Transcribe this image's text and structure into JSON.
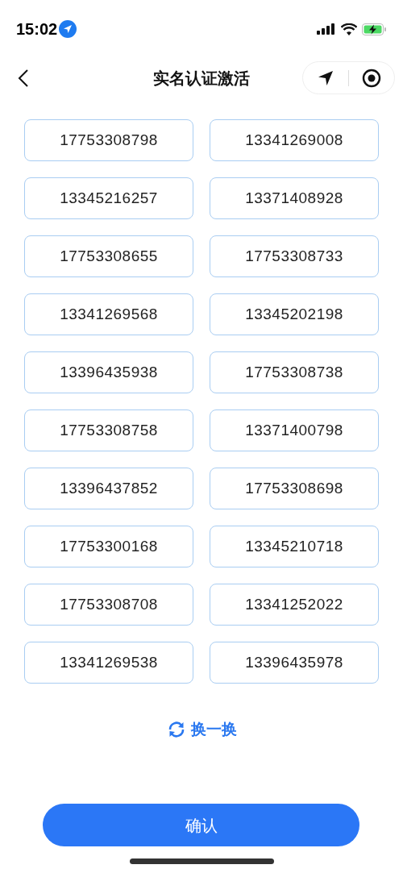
{
  "status_bar": {
    "time": "15:02"
  },
  "nav": {
    "title": "实名认证激活"
  },
  "numbers": [
    "17753308798",
    "13341269008",
    "13345216257",
    "13371408928",
    "17753308655",
    "17753308733",
    "13341269568",
    "13345202198",
    "13396435938",
    "17753308738",
    "17753308758",
    "13371400798",
    "13396437852",
    "17753308698",
    "17753300168",
    "13345210718",
    "17753308708",
    "13341252022",
    "13341269538",
    "13396435978"
  ],
  "refresh": {
    "label": "换一换"
  },
  "confirm": {
    "label": "确认"
  }
}
